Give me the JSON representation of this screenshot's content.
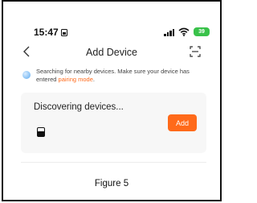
{
  "status_bar": {
    "time": "15:47",
    "battery": "39",
    "battery_color": "#39c24a"
  },
  "nav": {
    "title": "Add Device",
    "back_icon": "chevron-left-icon",
    "scan_icon": "scan-icon"
  },
  "hint": {
    "text": "Searching for nearby devices. Make sure your device has entered ",
    "link": "pairing mode",
    "suffix": "."
  },
  "card": {
    "title": "Discovering devices...",
    "add_label": "Add",
    "device_icon": "device-icon"
  },
  "caption": "Figure 5",
  "colors": {
    "accent": "#ff6a1a",
    "card_bg": "#f7f7f7"
  }
}
